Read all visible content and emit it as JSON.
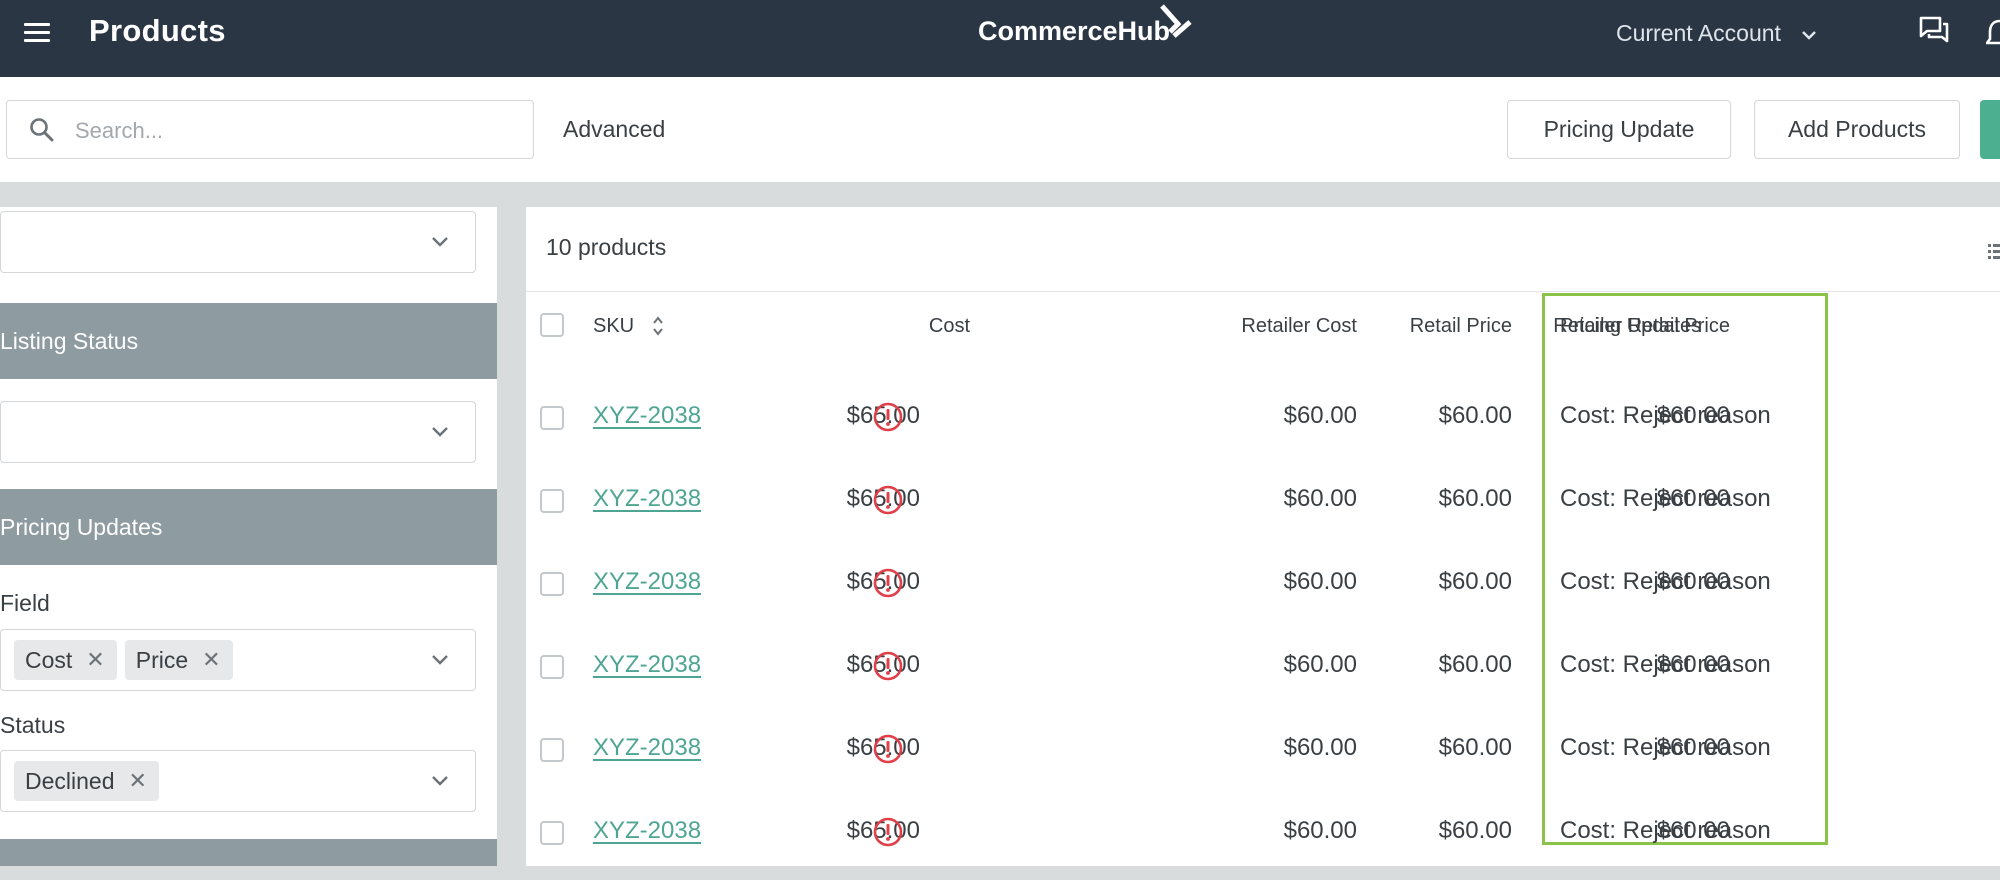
{
  "header": {
    "title": "Products",
    "brand": "CommerceHub",
    "account": "Current Account"
  },
  "toolbar": {
    "search_placeholder": "Search...",
    "advanced_label": "Advanced",
    "pricing_update_label": "Pricing Update",
    "add_products_label": "Add Products"
  },
  "sidebar": {
    "listing_status": "Listing Status",
    "pricing_updates": "Pricing Updates",
    "field_label": "Field",
    "field_chips": [
      "Cost",
      "Price"
    ],
    "status_label": "Status",
    "status_chips": [
      "Declined"
    ]
  },
  "table": {
    "count_label": "10 products",
    "columns": {
      "sku": "SKU",
      "cost": "Cost",
      "retailer_cost": "Retailer Cost",
      "retail_price": "Retail Price",
      "retailer_retail_price": "Retailer Retail Price",
      "pricing_updates": "Pricing Updates"
    },
    "rows": [
      {
        "sku": "XYZ-2038",
        "cost": "$65.00",
        "retailer_cost": "$60.00",
        "retail_price": "$60.00",
        "retailer_retail_price": "$60.00",
        "pricing_update": "Cost: Reject reason"
      },
      {
        "sku": "XYZ-2038",
        "cost": "$65.00",
        "retailer_cost": "$60.00",
        "retail_price": "$60.00",
        "retailer_retail_price": "$60.00",
        "pricing_update": "Cost: Reject reason"
      },
      {
        "sku": "XYZ-2038",
        "cost": "$65.00",
        "retailer_cost": "$60.00",
        "retail_price": "$60.00",
        "retailer_retail_price": "$60.00",
        "pricing_update": "Cost: Reject reason"
      },
      {
        "sku": "XYZ-2038",
        "cost": "$65.00",
        "retailer_cost": "$60.00",
        "retail_price": "$60.00",
        "retailer_retail_price": "$60.00",
        "pricing_update": "Cost: Reject reason"
      },
      {
        "sku": "XYZ-2038",
        "cost": "$65.00",
        "retailer_cost": "$60.00",
        "retail_price": "$60.00",
        "retailer_retail_price": "$60.00",
        "pricing_update": "Cost: Reject reason"
      },
      {
        "sku": "XYZ-2038",
        "cost": "$65.00",
        "retailer_cost": "$60.00",
        "retail_price": "$60.00",
        "retailer_retail_price": "$60.00",
        "pricing_update": "Cost: Reject reason"
      }
    ]
  },
  "icons": {
    "menu": "hamburger-icon",
    "logo": "commercehub-logo-icon",
    "account_chevron": "chevron-down-icon",
    "messages": "chat-icon",
    "notifications": "bell-icon",
    "search": "search-icon",
    "sort": "sort-icon",
    "warning": "alert-circle-icon",
    "list_view": "list-icon"
  },
  "colors": {
    "header_bg": "#2b3645",
    "link": "#4fa593",
    "warning": "#e0404a",
    "highlight": "#8bc34a",
    "section_head": "#8e9ba0",
    "primary_button": "#4caf8f"
  }
}
